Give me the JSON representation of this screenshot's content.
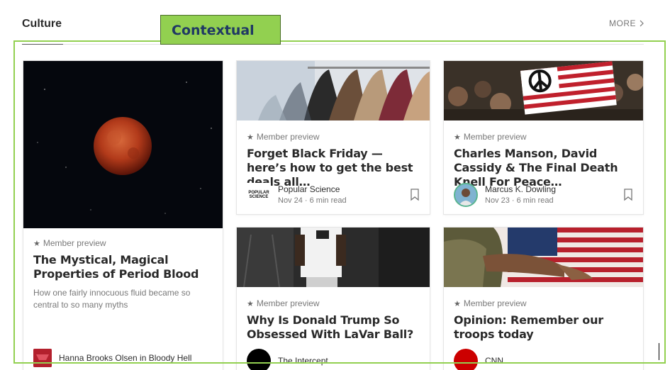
{
  "section": {
    "title": "Culture",
    "more_label": "MORE"
  },
  "annotation": {
    "label": "Contextual"
  },
  "cards": [
    {
      "preview_label": "Member preview",
      "title": "The Mystical, Magical Properties of Period Blood",
      "subtitle": "How one fairly innocuous fluid became so central to so many myths",
      "author": "Hanna Brooks Olsen in Bloody Hell"
    },
    {
      "preview_label": "Member preview",
      "title": "Forget Black Friday — here’s how to get the best deals all…",
      "author": "Popular Science",
      "meta": "Nov 24 · 6 min read",
      "logo_text": "POPULAR SCIENCE"
    },
    {
      "preview_label": "Member preview",
      "title": "Charles Manson, David Cassidy & The Final Death Knell For Peace…",
      "author": "Marcus K. Dowling",
      "meta": "Nov 23 · 6 min read"
    },
    {
      "preview_label": "Member preview",
      "title": "Why Is Donald Trump So Obsessed With LaVar Ball?",
      "author": "The Intercept"
    },
    {
      "preview_label": "Member preview",
      "title": "Opinion: Remember our troops today",
      "author": "CNN"
    }
  ],
  "colors": {
    "annotation_green": "#92d050",
    "annotation_text": "#1f3864"
  },
  "icons": {
    "star": "star-icon",
    "bookmark": "bookmark-icon",
    "chevron": "chevron-right-icon"
  }
}
